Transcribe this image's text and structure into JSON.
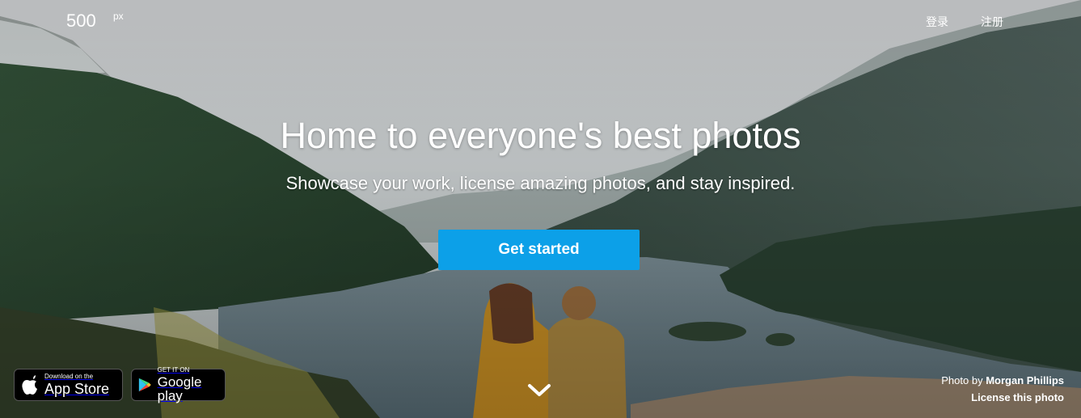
{
  "brand": {
    "logo_main": "500",
    "logo_sup": "px"
  },
  "nav": {
    "login": "登录",
    "signup": "注册"
  },
  "hero": {
    "headline": "Home to everyone's best photos",
    "subline": "Showcase your work, license amazing photos, and stay inspired.",
    "cta_label": "Get started"
  },
  "badges": {
    "apple_small": "Download on the",
    "apple_big": "App Store",
    "google_small": "GET IT ON",
    "google_big": "Google play"
  },
  "credit": {
    "prefix": "Photo by",
    "author": "Morgan Phillips",
    "license": "License this photo"
  },
  "colors": {
    "cta": "#0ca0e8",
    "text": "#ffffff"
  }
}
